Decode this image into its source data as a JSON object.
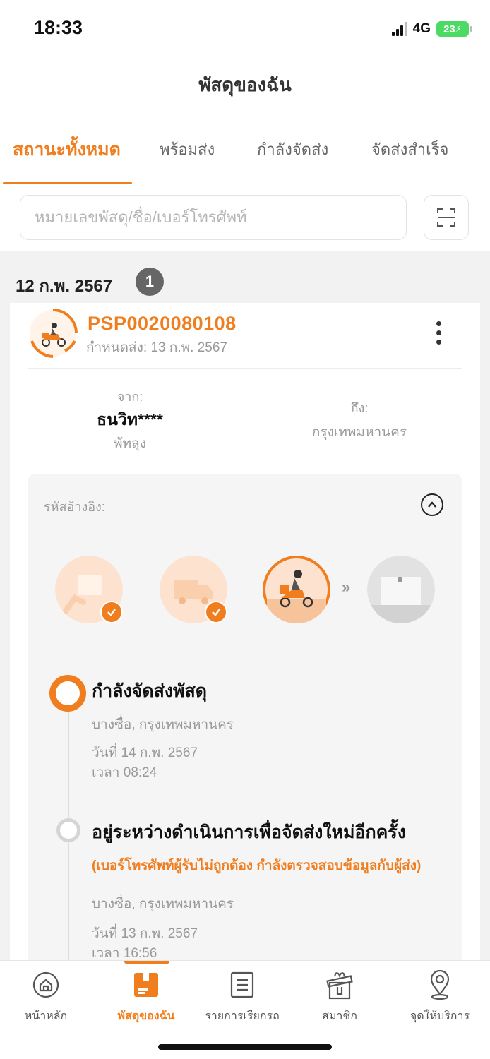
{
  "status_bar": {
    "time": "18:33",
    "network": "4G",
    "battery": "23"
  },
  "header": {
    "title": "พัสดุของฉัน"
  },
  "tabs": [
    {
      "label": "สถานะทั้งหมด",
      "active": true
    },
    {
      "label": "พร้อมส่ง"
    },
    {
      "label": "กำลังจัดส่ง"
    },
    {
      "label": "จัดส่งสำเร็จ"
    }
  ],
  "search": {
    "placeholder": "หมายเลขพัสดุ/ชื่อ/เบอร์โทรศัพท์",
    "value": ""
  },
  "group": {
    "date": "12 ก.พ. 2567",
    "count": "1"
  },
  "parcel": {
    "tracking_no": "PSP0020080108",
    "due_date": "กำหนดส่ง: 13 ก.พ. 2567",
    "from_label": "จาก:",
    "sender_name": "ธนวิท****",
    "from_city": "พัทลุง",
    "to_label": "ถึง:",
    "to_city": "กรุงเทพมหานคร",
    "ref_label": "รหัสอ้างอิง:",
    "stage_arrow": "»"
  },
  "timeline": [
    {
      "title": "กำลังจัดส่งพัสดุ",
      "location": "บางซื่อ, กรุงเทพมหานคร",
      "date": "วันที่ 14 ก.พ. 2567",
      "time": "เวลา 08:24"
    },
    {
      "title": "อยู่ระหว่างดำเนินการเพื่อจัดส่งใหม่อีกครั้ง",
      "note": "(เบอร์โทรศัพท์ผู้รับไม่ถูกต้อง กำลังตรวจสอบข้อมูลกับผู้ส่ง)",
      "location": "บางซื่อ, กรุงเทพมหานคร",
      "date": "วันที่ 13 ก.พ. 2567",
      "time": "เวลา 16:56"
    }
  ],
  "bottom_nav": [
    {
      "label": "หน้าหลัก",
      "icon": "home-icon"
    },
    {
      "label": "พัสดุของฉัน",
      "icon": "parcel-icon",
      "active": true
    },
    {
      "label": "รายการเรียกรถ",
      "icon": "list-icon"
    },
    {
      "label": "สมาชิก",
      "icon": "gift-icon"
    },
    {
      "label": "จุดให้บริการ",
      "icon": "location-pin-icon"
    }
  ],
  "colors": {
    "accent": "#f07d1e",
    "battery": "#4cd964"
  }
}
